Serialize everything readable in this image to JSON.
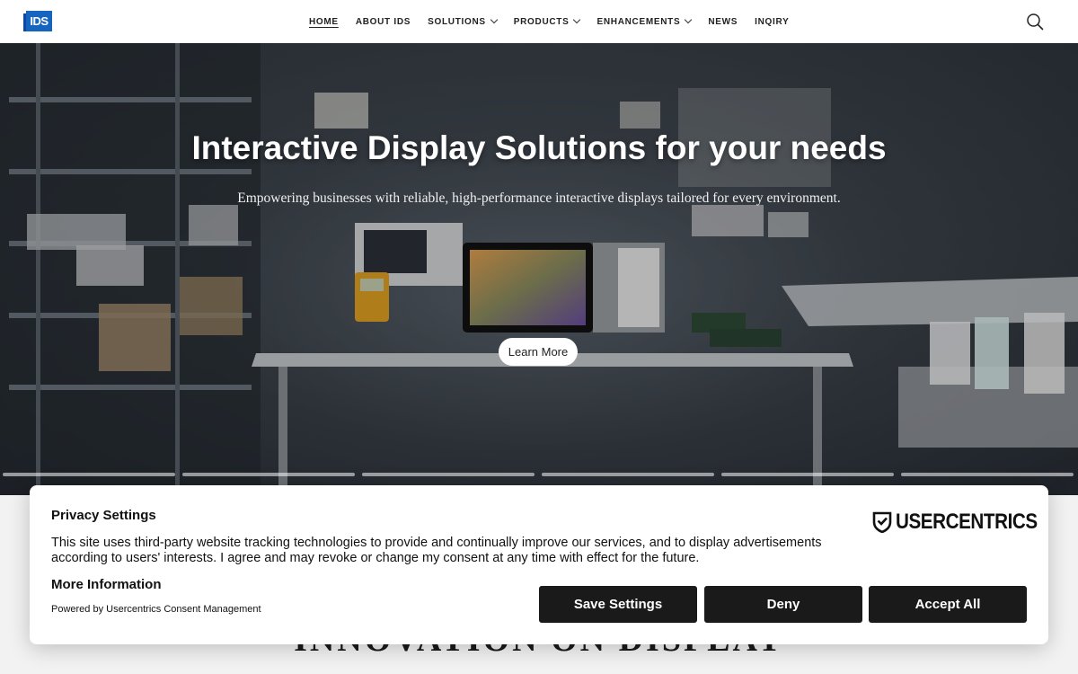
{
  "header": {
    "logo_text": "IDS",
    "nav": [
      {
        "label": "HOME",
        "active": true,
        "dropdown": false
      },
      {
        "label": "ABOUT IDS",
        "active": false,
        "dropdown": false
      },
      {
        "label": "SOLUTIONS",
        "active": false,
        "dropdown": true
      },
      {
        "label": "PRODUCTS",
        "active": false,
        "dropdown": true
      },
      {
        "label": "ENHANCEMENTS",
        "active": false,
        "dropdown": true
      },
      {
        "label": "NEWS",
        "active": false,
        "dropdown": false
      },
      {
        "label": "INQIRY",
        "active": false,
        "dropdown": false
      }
    ],
    "search_icon": "search-icon"
  },
  "hero": {
    "title": "Interactive Display Solutions for your needs",
    "subtitle": "Empowering businesses with reliable, high-performance interactive displays tailored for every environment.",
    "cta_label": "Learn More",
    "slide_count": 6
  },
  "section": {
    "title": "INNOVATION ON DISPLAY"
  },
  "consent": {
    "title": "Privacy Settings",
    "text": "This site uses third-party website tracking technologies to provide and continually improve our services, and to display advertisements according to users' interests. I agree and may revoke or change my consent at any time with effect for the future.",
    "more_info": "More Information",
    "powered_by": "Powered by Usercentrics Consent Management",
    "brand": "USERCENTRICS",
    "buttons": {
      "save": "Save Settings",
      "deny": "Deny",
      "accept": "Accept All"
    }
  },
  "colors": {
    "logo_blue": "#1565c0",
    "button_dark": "#1a1a1a"
  }
}
